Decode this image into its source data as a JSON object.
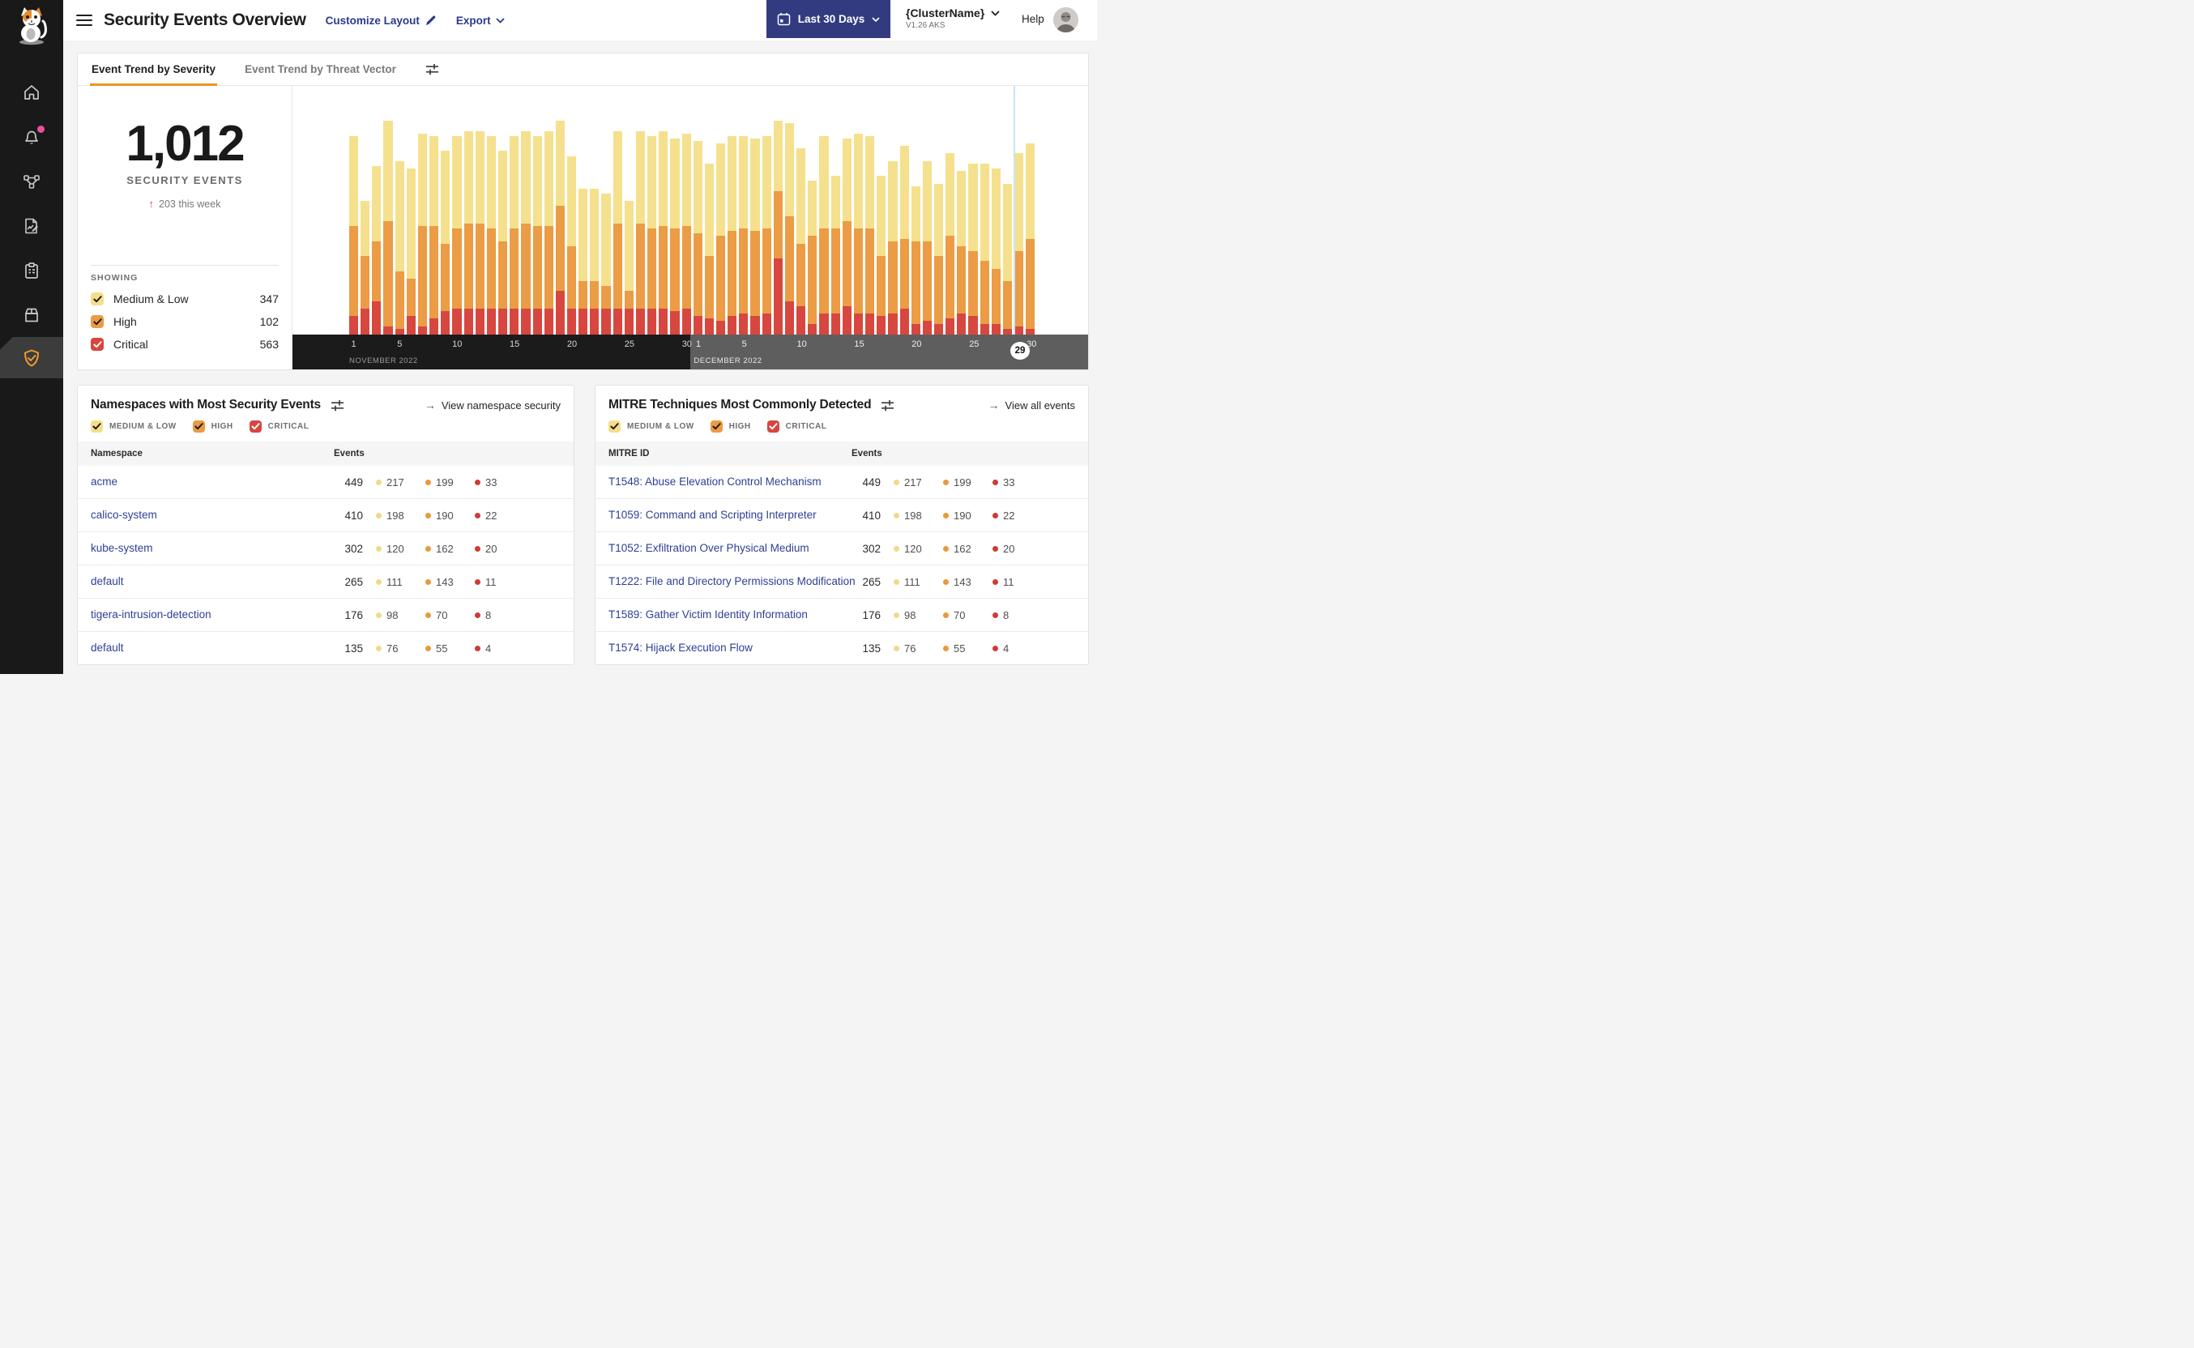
{
  "colors": {
    "medium": "#F5E18D",
    "high": "#EB9C44",
    "critical": "#D7473F",
    "dot_medium": "#EFDA8A",
    "dot_high": "#E8983F",
    "dot_critical": "#CF3B35",
    "accent_orange": "#EF931F",
    "navy_button": "#323B80",
    "link_navy": "#2B3A8F",
    "row_link": "#2D3F96",
    "notification_pink": "#EE4F9C",
    "selection_line": "#C9E4F6",
    "axis_nov_bg": "#1B1B1B",
    "axis_dec_bg": "#5E5E5E",
    "sidebar_bg": "#191919"
  },
  "sidebar": {
    "items": [
      {
        "icon": "home-icon"
      },
      {
        "icon": "notifications-bell-icon",
        "badge": "unread-dot"
      },
      {
        "icon": "network-graph-icon"
      },
      {
        "icon": "report-edit-icon"
      },
      {
        "icon": "clipboard-list-icon"
      },
      {
        "icon": "package-box-icon"
      },
      {
        "icon": "security-shield-icon",
        "active": true
      }
    ]
  },
  "header": {
    "title": "Security Events Overview",
    "customize_label": "Customize Layout",
    "export_label": "Export",
    "date_range_label": "Last 30 Days",
    "cluster_name": "{ClusterName}",
    "cluster_version": "V1.26 AKS",
    "help_label": "Help"
  },
  "trend_panel": {
    "tabs": [
      {
        "label": "Event Trend by Severity",
        "active": true
      },
      {
        "label": "Event Trend by Threat Vector",
        "active": false
      }
    ],
    "stat": {
      "total": "1,012",
      "caption": "SECURITY EVENTS",
      "delta_arrow": "↑",
      "delta": "203 this week"
    },
    "showing": {
      "label": "SHOWING",
      "items": [
        {
          "label": "Medium & Low",
          "count": "347",
          "color": "#F6DE8B",
          "check": "dark",
          "checked": true
        },
        {
          "label": "High",
          "count": "102",
          "color": "#EA9B43",
          "check": "dark",
          "checked": true
        },
        {
          "label": "Critical",
          "count": "563",
          "color": "#D8453F",
          "check": "light",
          "checked": true
        }
      ]
    }
  },
  "chart_data": {
    "type": "bar",
    "subtype": "stacked-daily",
    "series": [
      {
        "name": "Medium & Low",
        "color": "#F5E18D"
      },
      {
        "name": "High",
        "color": "#EB9C44"
      },
      {
        "name": "Critical",
        "color": "#D7473F"
      }
    ],
    "months": [
      {
        "label": "NOVEMBER 2022",
        "start_index": 0,
        "days": 30
      },
      {
        "label": "DECEMBER 2022",
        "start_index": 30,
        "days": 30
      }
    ],
    "x_ticks": [
      {
        "label": "1",
        "index": 0
      },
      {
        "label": "5",
        "index": 4
      },
      {
        "label": "10",
        "index": 9
      },
      {
        "label": "15",
        "index": 14
      },
      {
        "label": "20",
        "index": 19
      },
      {
        "label": "25",
        "index": 24
      },
      {
        "label": "30",
        "index": 29
      },
      {
        "label": "1",
        "index": 30
      },
      {
        "label": "5",
        "index": 34
      },
      {
        "label": "10",
        "index": 39
      },
      {
        "label": "15",
        "index": 44
      },
      {
        "label": "20",
        "index": 49
      },
      {
        "label": "25",
        "index": 54
      },
      {
        "label": "30",
        "index": 59
      }
    ],
    "selected_day": {
      "label": "29",
      "index": 58
    },
    "bars_note": "each bar = [medium, high, critical] as % of plot height, Nov 1 - Dec 30 2022",
    "bars": [
      [
        36,
        36,
        8
      ],
      [
        22,
        21,
        11
      ],
      [
        30,
        24,
        14
      ],
      [
        40,
        42,
        4
      ],
      [
        44,
        23,
        3
      ],
      [
        44,
        15,
        8
      ],
      [
        37,
        40,
        4
      ],
      [
        36,
        37,
        7
      ],
      [
        37,
        27,
        10
      ],
      [
        37,
        32,
        11
      ],
      [
        37,
        34,
        11
      ],
      [
        37,
        34,
        11
      ],
      [
        37,
        32,
        11
      ],
      [
        36,
        27,
        11
      ],
      [
        37,
        32,
        11
      ],
      [
        37,
        34,
        11
      ],
      [
        36,
        33,
        11
      ],
      [
        38,
        33,
        11
      ],
      [
        34,
        34,
        18
      ],
      [
        36,
        25,
        11
      ],
      [
        37,
        11,
        11
      ],
      [
        37,
        11,
        11
      ],
      [
        37,
        9,
        11
      ],
      [
        37,
        34,
        11
      ],
      [
        36,
        7,
        11
      ],
      [
        37,
        34,
        11
      ],
      [
        37,
        32,
        11
      ],
      [
        38,
        33,
        11
      ],
      [
        36,
        33,
        10
      ],
      [
        37,
        33,
        11
      ],
      [
        37,
        33,
        8
      ],
      [
        37,
        25,
        7
      ],
      [
        37,
        34,
        6
      ],
      [
        38,
        34,
        8
      ],
      [
        37,
        34,
        9
      ],
      [
        37,
        34,
        8
      ],
      [
        37,
        34,
        9
      ],
      [
        28,
        27,
        31
      ],
      [
        37,
        34,
        14
      ],
      [
        38,
        25,
        12
      ],
      [
        22,
        35,
        5
      ],
      [
        37,
        34,
        9
      ],
      [
        21,
        34,
        9
      ],
      [
        33,
        34,
        12
      ],
      [
        38,
        34,
        9
      ],
      [
        37,
        34,
        9
      ],
      [
        32,
        24,
        8
      ],
      [
        32,
        29,
        9
      ],
      [
        37,
        28,
        11
      ],
      [
        22,
        33,
        5
      ],
      [
        32,
        32,
        6
      ],
      [
        29,
        27,
        5
      ],
      [
        33,
        33,
        7
      ],
      [
        30,
        27,
        9
      ],
      [
        35,
        26,
        8
      ],
      [
        39,
        25,
        5
      ],
      [
        40,
        22,
        5
      ],
      [
        39,
        19,
        3
      ],
      [
        39,
        30,
        4
      ],
      [
        38,
        36,
        3
      ]
    ]
  },
  "cards": [
    {
      "title": "Namespaces with Most Security Events",
      "link": "View namespace security",
      "link_arrow": "→",
      "filters": [
        {
          "label": "MEDIUM & LOW",
          "color": "#F6DE8B",
          "check": "dark",
          "checked": true
        },
        {
          "label": "HIGH",
          "color": "#EA9B43",
          "check": "dark",
          "checked": true
        },
        {
          "label": "CRITICAL",
          "color": "#D8453F",
          "check": "light",
          "checked": true
        }
      ],
      "columns": [
        "Namespace",
        "Events"
      ],
      "rows": [
        {
          "name": "acme",
          "total": "449",
          "medium": "217",
          "high": "199",
          "critical": "33"
        },
        {
          "name": "calico-system",
          "total": "410",
          "medium": "198",
          "high": "190",
          "critical": "22"
        },
        {
          "name": "kube-system",
          "total": "302",
          "medium": "120",
          "high": "162",
          "critical": "20"
        },
        {
          "name": "default",
          "total": "265",
          "medium": "111",
          "high": "143",
          "critical": "11"
        },
        {
          "name": "tigera-intrusion-detection",
          "total": "176",
          "medium": "98",
          "high": "70",
          "critical": "8"
        },
        {
          "name": "default",
          "total": "135",
          "medium": "76",
          "high": "55",
          "critical": "4"
        }
      ]
    },
    {
      "title": "MITRE Techniques Most Commonly Detected",
      "link": "View all events",
      "link_arrow": "→",
      "filters": [
        {
          "label": "MEDIUM & LOW",
          "color": "#F6DE8B",
          "check": "dark",
          "checked": true
        },
        {
          "label": "HIGH",
          "color": "#EA9B43",
          "check": "dark",
          "checked": true
        },
        {
          "label": "CRITICAL",
          "color": "#D8453F",
          "check": "light",
          "checked": true
        }
      ],
      "columns": [
        "MITRE ID",
        "Events"
      ],
      "rows": [
        {
          "name": "T1548: Abuse Elevation Control Mechanism",
          "total": "449",
          "medium": "217",
          "high": "199",
          "critical": "33"
        },
        {
          "name": "T1059: Command and Scripting Interpreter",
          "total": "410",
          "medium": "198",
          "high": "190",
          "critical": "22"
        },
        {
          "name": "T1052: Exfiltration Over Physical Medium",
          "total": "302",
          "medium": "120",
          "high": "162",
          "critical": "20"
        },
        {
          "name": "T1222: File and Directory Permissions Modification",
          "total": "265",
          "medium": "111",
          "high": "143",
          "critical": "11"
        },
        {
          "name": "T1589: Gather Victim Identity Information",
          "total": "176",
          "medium": "98",
          "high": "70",
          "critical": "8"
        },
        {
          "name": "T1574: Hijack Execution Flow",
          "total": "135",
          "medium": "76",
          "high": "55",
          "critical": "4"
        }
      ]
    }
  ]
}
